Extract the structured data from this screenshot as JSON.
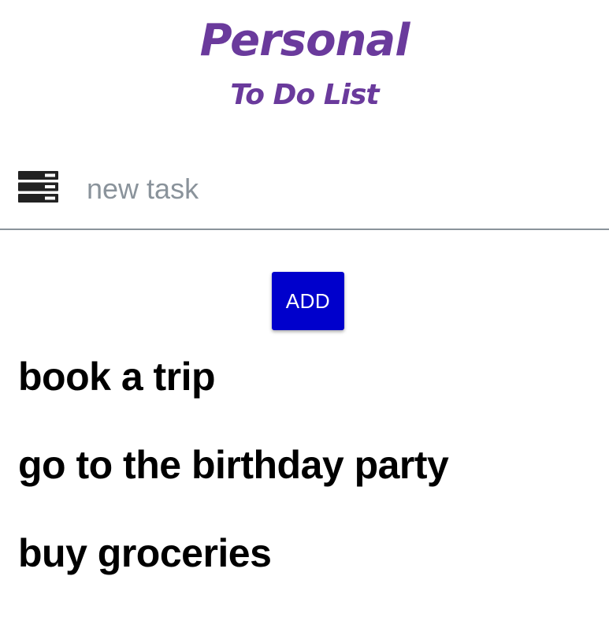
{
  "header": {
    "title": "Personal",
    "subtitle": "To Do List"
  },
  "new_task": {
    "icon": "list-icon",
    "value": "",
    "placeholder": "new task"
  },
  "add_button": {
    "label": "ADD"
  },
  "tasks": [
    {
      "label": "book a trip"
    },
    {
      "label": "go to the birthday party"
    },
    {
      "label": "buy groceries"
    }
  ],
  "colors": {
    "title": "#6a3a9c",
    "button": "#0000cc",
    "input_underline": "#8a939b",
    "placeholder": "#8a939b",
    "task_text": "#000000"
  }
}
